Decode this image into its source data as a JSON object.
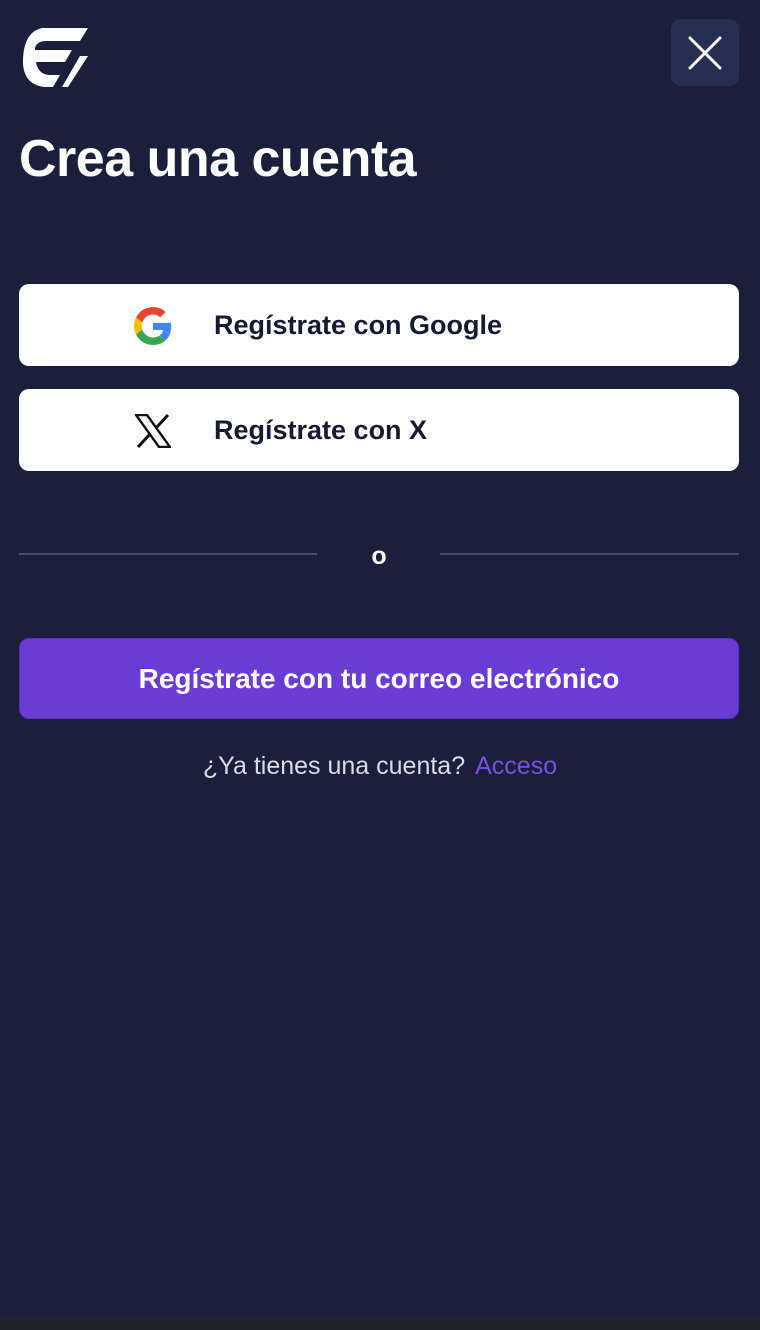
{
  "header": {
    "logo_icon": "brand-logo-icon",
    "close_icon": "close-icon"
  },
  "title": "Crea una cuenta",
  "social": {
    "google": {
      "label": "Regístrate con Google",
      "icon": "google-icon"
    },
    "x": {
      "label": "Regístrate con X",
      "icon": "x-icon"
    }
  },
  "divider": {
    "text": "o"
  },
  "email_button": {
    "label": "Regístrate con tu correo electrónico"
  },
  "login": {
    "question": "¿Ya tienes una cuenta?",
    "link": "Acceso"
  },
  "colors": {
    "background": "#1b1f3b",
    "close_button_bg": "#262e52",
    "accent": "#6b3bd5",
    "link": "#7a4fdf",
    "social_button_bg": "#ffffff",
    "divider": "#474d6c"
  }
}
